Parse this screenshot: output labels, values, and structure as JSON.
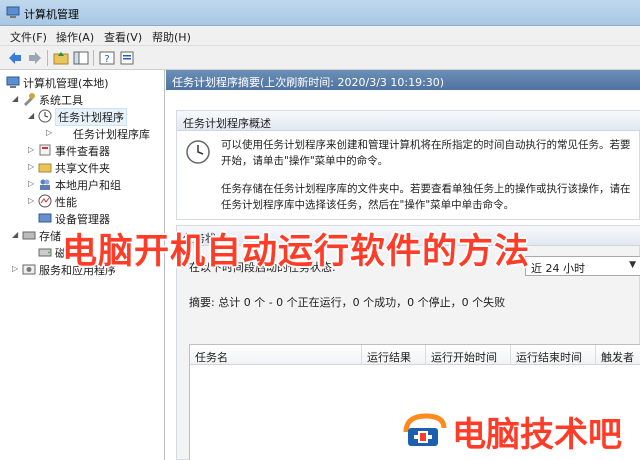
{
  "window": {
    "title": "计算机管理"
  },
  "menu": [
    "文件(F)",
    "操作(A)",
    "查看(V)",
    "帮助(H)"
  ],
  "tree": {
    "root": "计算机管理(本地)",
    "items": [
      {
        "label": "系统工具"
      },
      {
        "label": "任务计划程序"
      },
      {
        "label": "任务计划程序库"
      },
      {
        "label": "事件查看器"
      },
      {
        "label": "共享文件夹"
      },
      {
        "label": "本地用户和组"
      },
      {
        "label": "性能"
      },
      {
        "label": "设备管理器"
      },
      {
        "label": "存储"
      },
      {
        "label": "磁盘"
      },
      {
        "label": "服务和应用程序"
      }
    ]
  },
  "right": {
    "header": "任务计划程序摘要(上次刷新时间: 2020/3/3 10:19:30)",
    "overview": {
      "title": "任务计划程序概述",
      "para1_line1": "可以使用任务计划程序来创建和管理计算机将在所指定的时间自动执行的常见任务。若要",
      "para1_line2": "开始，请单击\"操作\"菜单中的命令。",
      "para2_line1": "任务存储在任务计划程序库的文件夹中。若要查看单独任务上的操作或执行该操作，请在",
      "para2_line2": "任务计划程序库中选择该任务，然后在\"操作\"菜单中单击命令。"
    },
    "status": {
      "title": "任务状",
      "filter_label": "在以下时间段启动的任务状态:",
      "filter_value": "近 24 小时",
      "summary": "摘要: 总计 0 个 - 0 个正在运行，0 个成功，0 个停止，0 个失败",
      "columns": [
        "任务名",
        "运行结果",
        "运行开始时间",
        "运行结束时间",
        "触发者"
      ]
    }
  },
  "overlay": {
    "title": "电脑开机自动运行软件的方法"
  },
  "watermark": {
    "text": "电脑技术吧"
  },
  "colors": {
    "accent": "#ff3c28",
    "header": "#5c80ab"
  }
}
